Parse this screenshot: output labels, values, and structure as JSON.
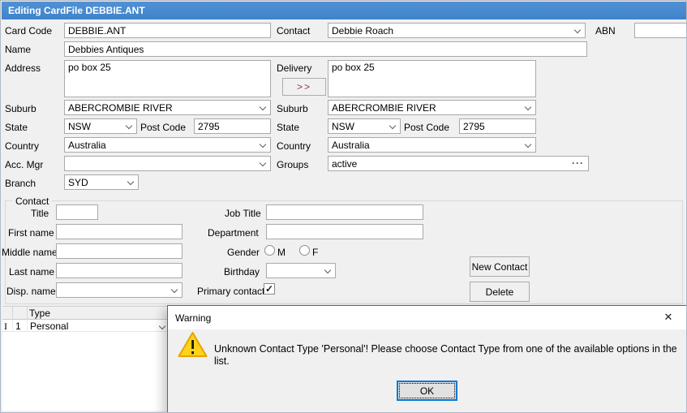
{
  "window": {
    "title": "Editing CardFile DEBBIE.ANT",
    "titlebar_color": "#4589cf"
  },
  "form": {
    "card_code": {
      "label": "Card Code",
      "value": "DEBBIE.ANT"
    },
    "contact": {
      "label": "Contact",
      "value": "Debbie Roach"
    },
    "abn": {
      "label": "ABN",
      "value": ""
    },
    "name": {
      "label": "Name",
      "value": "Debbies Antiques"
    },
    "address": {
      "label": "Address",
      "value": "po box 25"
    },
    "delivery": {
      "label": "Delivery",
      "value": "po box 25",
      "copy_button_label": ">>"
    },
    "suburb": {
      "label": "Suburb",
      "value": "ABERCROMBIE RIVER"
    },
    "state": {
      "label": "State",
      "value": "NSW"
    },
    "post_code": {
      "label": "Post Code",
      "value": "2795"
    },
    "country": {
      "label": "Country",
      "value": "Australia"
    },
    "delivery_suburb": {
      "label": "Suburb",
      "value": "ABERCROMBIE RIVER"
    },
    "delivery_state": {
      "label": "State",
      "value": "NSW"
    },
    "delivery_post_code": {
      "label": "Post Code",
      "value": "2795"
    },
    "delivery_country": {
      "label": "Country",
      "value": "Australia"
    },
    "acc_mgr": {
      "label": "Acc. Mgr",
      "value": ""
    },
    "groups": {
      "label": "Groups",
      "value": "active",
      "ellipsis_button": "···"
    },
    "branch": {
      "label": "Branch",
      "value": "SYD"
    }
  },
  "contact_group": {
    "legend": "Contact",
    "title": {
      "label": "Title",
      "value": ""
    },
    "first_name": {
      "label": "First name",
      "value": ""
    },
    "middle_name": {
      "label": "Middle name",
      "value": ""
    },
    "last_name": {
      "label": "Last name",
      "value": ""
    },
    "disp_name": {
      "label": "Disp. name",
      "value": ""
    },
    "job_title": {
      "label": "Job Title",
      "value": ""
    },
    "department": {
      "label": "Department",
      "value": ""
    },
    "gender": {
      "label": "Gender",
      "male_label": "M",
      "female_label": "F"
    },
    "birthday": {
      "label": "Birthday",
      "value": ""
    },
    "primary_contact": {
      "label": "Primary contact",
      "checked": true,
      "checkmark": "✓"
    },
    "new_contact_button": "New Contact",
    "delete_button": "Delete"
  },
  "grid": {
    "type_column_header": "Type",
    "rows": [
      {
        "indicator": "I",
        "row_number": "1",
        "type": "Personal"
      }
    ]
  },
  "warning_dialog": {
    "title": "Warning",
    "close_icon": "✕",
    "message": "Unknown Contact Type 'Personal'! Please choose Contact Type from one of the available options in the list.",
    "ok_button": "OK",
    "exclamation": "!",
    "colors": {
      "warning_yellow": "#ffd21c",
      "warning_border": "#e8a400",
      "focus_blue": "#0078d7"
    }
  }
}
